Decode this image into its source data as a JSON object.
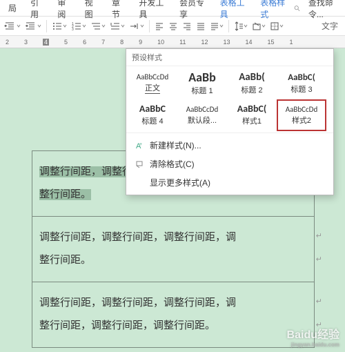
{
  "menu": {
    "m0": "局",
    "m1": "引用",
    "m2": "审阅",
    "m3": "视图",
    "m4": "章节",
    "m5": "开发工具",
    "m6": "会员专享",
    "m7": "表格工具",
    "m8": "表格样式",
    "search": "查找命令..."
  },
  "toolbar_right": "文字",
  "ruler": [
    "2",
    "3",
    "4",
    "5",
    "6",
    "7",
    "8",
    "9",
    "10",
    "11",
    "12",
    "13",
    "14",
    "15",
    "1"
  ],
  "panel": {
    "title": "预设样式",
    "s0p": "AaBbCcDd",
    "s0l": "正文",
    "s1p": "AaBb",
    "s1l": "标题 1",
    "s2p": "AaBb(",
    "s2l": "标题 2",
    "s3p": "AaBbC(",
    "s3l": "标题 3",
    "s4p": "AaBbC",
    "s4l": "标题 4",
    "s5p": "AaBbCcDd",
    "s5l": "默认段...",
    "s6p": "AaBbC(",
    "s6l": "样式1",
    "s7p": "AaBbCcDd",
    "s7l": "样式2",
    "menu0": "新建样式(N)...",
    "menu1": "清除格式(C)",
    "menu2": "显示更多样式(A)"
  },
  "cells": {
    "c0a": "调整行间距，调整行间距，调整行间距，调",
    "c0b": "整行间距。",
    "c1a": "调整行间距，调整行间距，调整行间距，调",
    "c1b": "整行间距。",
    "c2a": "调整行间距，调整行间距，调整行间距，调",
    "c2b": "整行间距，调整行间距，调整行间距。"
  },
  "wm": "Baidu经验"
}
